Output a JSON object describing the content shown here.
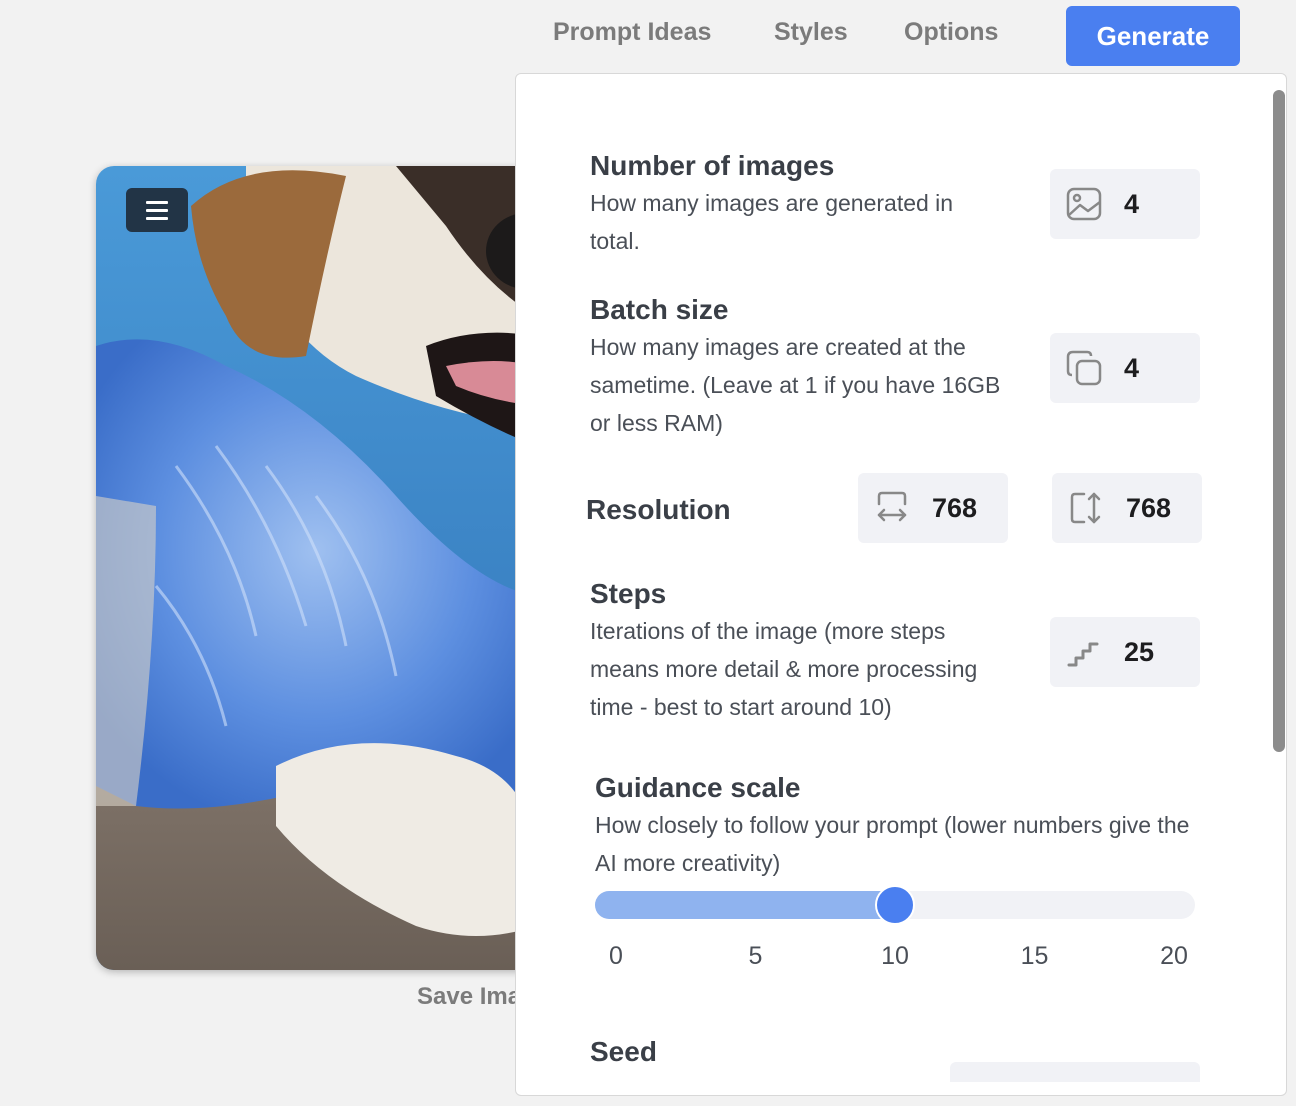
{
  "nav": {
    "prompt_ideas": "Prompt Ideas",
    "styles": "Styles",
    "options": "Options",
    "generate": "Generate"
  },
  "image_card": {
    "save_label": "Save Ima"
  },
  "colors": {
    "accent": "#4a7ff0",
    "slider_fill": "#8fb3ef",
    "field_bg": "#f1f2f6",
    "menu_button": "#223446"
  },
  "options": {
    "num_images": {
      "title": "Number of images",
      "desc": "How many images are generated in total.",
      "icon": "image-icon",
      "value": "4"
    },
    "batch_size": {
      "title": "Batch size",
      "desc": "How many images are created at the sametime. (Leave at 1 if you have 16GB or less RAM)",
      "icon": "copy-icon",
      "value": "4"
    },
    "resolution": {
      "title": "Resolution",
      "width_icon": "width-arrows-icon",
      "width": "768",
      "height_icon": "height-arrows-icon",
      "height": "768"
    },
    "steps": {
      "title": "Steps",
      "desc": "Iterations of the image (more steps means more detail & more processing time - best to start around 10)",
      "icon": "stairs-icon",
      "value": "25"
    },
    "guidance": {
      "title": "Guidance scale",
      "desc": "How closely to follow your prompt (lower numbers give the AI more creativity)",
      "min": 0,
      "max": 20,
      "value": 10,
      "ticks": [
        "0",
        "5",
        "10",
        "15",
        "20"
      ]
    },
    "seed": {
      "title": "Seed"
    }
  }
}
